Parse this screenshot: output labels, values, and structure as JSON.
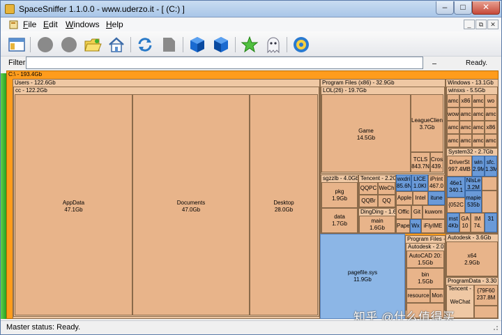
{
  "window": {
    "title": "SpaceSniffer 1.1.0.0 - www.uderzo.it - [ (C:) ]",
    "minimize": "–",
    "maximize": "□",
    "close": "✕"
  },
  "menu": {
    "items": [
      "File",
      "Edit",
      "Windows",
      "Help"
    ],
    "mdi": [
      "_",
      "⧉",
      "✕"
    ]
  },
  "toolbar": {
    "buttons": [
      "new-view",
      "back",
      "forward",
      "folder-open",
      "home",
      "refresh",
      "document",
      "cube-blue",
      "cube-blue-2",
      "star",
      "ghost",
      "settings"
    ]
  },
  "filter": {
    "label": "Filter",
    "value": "",
    "status": "Ready.",
    "indicator": "_"
  },
  "treemap": {
    "root": "C:\\ - 193.4Gb",
    "users": "Users - 122.6Gb",
    "cc": "cc - 122.2Gb",
    "appdata": {
      "name": "AppData",
      "size": "47.1Gb"
    },
    "documents": {
      "name": "Documents",
      "size": "47.0Gb"
    },
    "desktop": {
      "name": "Desktop",
      "size": "28.0Gb"
    },
    "programfiles86": "Program Files (x86) - 32.9Gb",
    "lol": "LOL(26) - 19.7Gb",
    "game": {
      "name": "Game",
      "size": "14.5Gb"
    },
    "leagueclient": {
      "name": "LeagueClien",
      "size": "3.7Gb"
    },
    "tcls": {
      "name": "TCLS",
      "size": "843.7N"
    },
    "cros": {
      "name": "Cros",
      "size": "439."
    },
    "sgzzlb": "sgzzlb - 4.0Gb",
    "pkg": {
      "name": "pkg",
      "size": "1.9Gb"
    },
    "data": {
      "name": "data",
      "size": "1.7Gb"
    },
    "tencent": "Tencent - 2.2G",
    "qqpc": "QQPC",
    "wechat": "WeCh",
    "qqbr": "QQBr",
    "qq": "QQ",
    "dingding": "DingDing - 1.6",
    "main": {
      "name": "main",
      "size": "1.6Gb"
    },
    "wxdr": {
      "name": "wxdri",
      "size": "85.6N"
    },
    "lice": {
      "name": "LICE",
      "size": "1.0Kl"
    },
    "iprint": {
      "name": "iPrint",
      "size": "467.0"
    },
    "apple": "Apple",
    "intel": "Intel",
    "itune": "itune",
    "office": "Offic",
    "git": "Git",
    "kuwo": "kuwom",
    "pap": "Pape",
    "wx": "Wx",
    "iflyime": "iFlyIME",
    "pagefile": {
      "name": "pagefile.sys",
      "size": "11.9Gb"
    },
    "programfiles": "Program Files -",
    "autodesk1": "Autodesk - 2.0",
    "autocad": {
      "name": "AutoCAD 20:",
      "size": "1.5Gb"
    },
    "bin": {
      "name": "bin",
      "size": "1.5Gb"
    },
    "resource": "resource",
    "mon": "Mon",
    "windows": "Windows - 13.1Gb",
    "winsxs": "winsxs - 5.5Gb",
    "winsxs_cells": [
      "amc",
      "x86",
      "amc",
      "wo",
      "wow",
      "amc",
      "amc",
      "amc",
      "amc",
      "amc",
      "amc",
      "x86",
      "amc",
      "amc",
      "amc",
      "amc"
    ],
    "system32": "System32 - 2.7Gb",
    "driverstore": {
      "name": "DriverSt",
      "size": "997.4MB"
    },
    "win": {
      "name": "win",
      "size": "2.9M"
    },
    "sfc": {
      "name": "sfc.",
      "size": "1.3M"
    },
    "s46e1": {
      "name": "46e1",
      "size": "340.1"
    },
    "nlsle": {
      "name": "NlsLe",
      "size": "3.2M"
    },
    "s0520": "{052C",
    "mapie": {
      "name": "mapie",
      "size": "535b"
    },
    "mst": {
      "name": "mst",
      "size": "4Kb"
    },
    "ga": {
      "name": "GA",
      "size": "10"
    },
    "im": {
      "name": "IM",
      "size": "74."
    },
    "s31": {
      "name": "31",
      "size": ""
    },
    "autodesk2": "Autodesk - 3.6Gb",
    "x64": {
      "name": "x64",
      "size": "2.9Gb"
    },
    "programdata": "ProgramData - 3.30",
    "tencent2": "Tencent - 1.",
    "wechat2": "WeChat",
    "s79f6": {
      "name": "{79F60",
      "size": "237.8M"
    }
  },
  "status": {
    "text": "Master status: Ready."
  },
  "watermark": "知乎 @什么值得买",
  "colors": {
    "root": "#ff9c1c",
    "folder": "#e8b48a",
    "file": "#8cb6e6",
    "active": "#30a020"
  }
}
